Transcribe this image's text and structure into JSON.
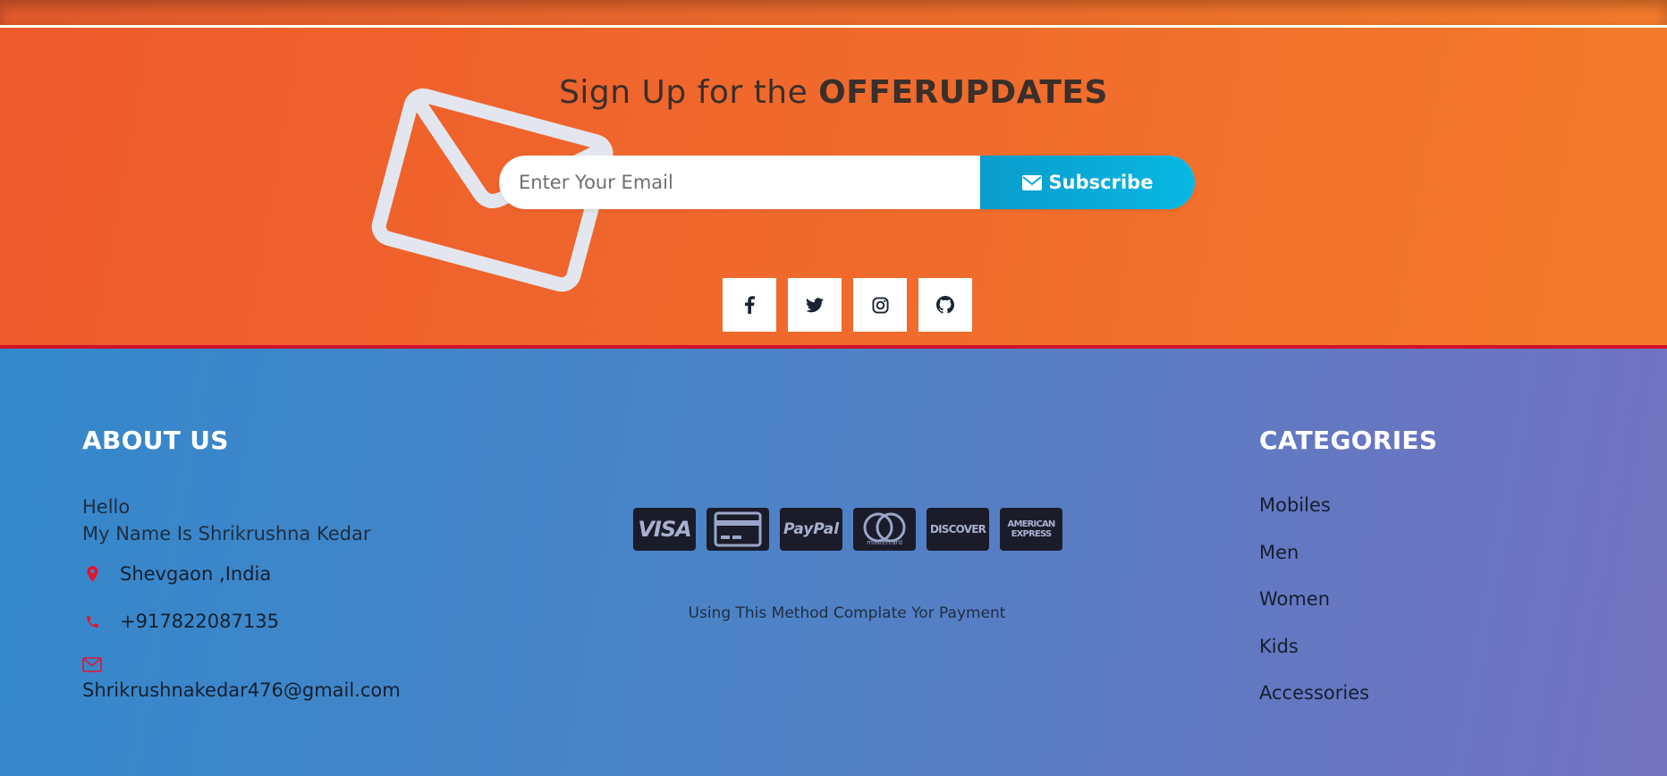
{
  "newsletter": {
    "title_prefix": "Sign Up for the ",
    "title_bold": "OFFERUPDATES",
    "email_placeholder": "Enter Your Email",
    "subscribe_label": "Subscribe",
    "socials": [
      "facebook-icon",
      "twitter-icon",
      "instagram-icon",
      "github-icon"
    ]
  },
  "about": {
    "title": "ABOUT US",
    "line1": "Hello",
    "line2": "My Name Is Shrikrushna Kedar",
    "location": "Shevgaon ,India",
    "phone": "+917822087135",
    "email": "Shrikrushnakedar476@gmail.com"
  },
  "payment": {
    "cards": [
      "VISA",
      "card-icon",
      "PayPal",
      "mastercard",
      "DISCOVER",
      "AMERICAN EXPRESS"
    ],
    "note": "Using This Method Complate Yor Payment"
  },
  "categories": {
    "title": "CATEGORIES",
    "items": [
      "Mobiles",
      "Men",
      "Women",
      "Kids",
      "Accessories"
    ]
  },
  "colors": {
    "accent_orange": "#f06b2c",
    "subscribe_blue": "#08b7e2",
    "footer_blue": "#3388cc",
    "icon_red": "#e5142f"
  }
}
